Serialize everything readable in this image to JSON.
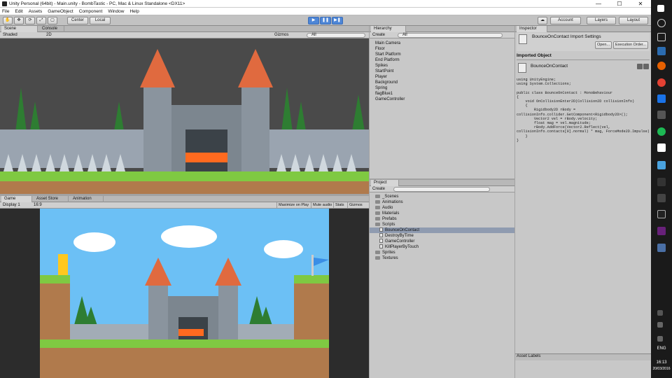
{
  "window": {
    "title": "Unity Personal (64bit) - Main.unity - BombTastic - PC, Mac & Linux Standalone <DX11>",
    "minimize": "—",
    "maximize": "☐",
    "close": "✕"
  },
  "menu": [
    "File",
    "Edit",
    "Assets",
    "GameObject",
    "Component",
    "Window",
    "Help"
  ],
  "toolbar": {
    "pivot": "Center",
    "space": "Local",
    "account": "Account",
    "layers": "Layers",
    "layout": "Layout",
    "play_icon": "▶",
    "pause_icon": "❚❚",
    "step_icon": "▶❚"
  },
  "scene": {
    "tabs": [
      "Scene",
      "Console"
    ],
    "shading": "Shaded",
    "mode_2d": "2D",
    "gizmos": "Gizmos",
    "search_placeholder": "All"
  },
  "game": {
    "tabs": [
      "Game",
      "Asset Store",
      "Animation"
    ],
    "display": "Display 1",
    "aspect": "16:9",
    "toggles": [
      "Maximize on Play",
      "Mute audio",
      "Stats",
      "Gizmos"
    ]
  },
  "hierarchy": {
    "title": "Hierarchy",
    "create": "Create",
    "search_placeholder": "All",
    "items": [
      "Main Camera",
      "Floor",
      "Start Platform",
      "End Platform",
      "Spikes",
      "StartPoint",
      "Player",
      "Background",
      "Spring",
      "flagBlue1",
      "GameController"
    ]
  },
  "project": {
    "title": "Project",
    "create": "Create",
    "folders": [
      "_Scenes",
      "Animations",
      "Audio",
      "Materials",
      "Prefabs",
      "Scripts",
      "Sprites",
      "Textures"
    ],
    "scripts": [
      "BounceOnContact",
      "DestroyByTime",
      "GameController",
      "KillPlayerByTouch"
    ]
  },
  "inspector": {
    "title": "Inspector",
    "import_title": "BounceOnContact Import Settings",
    "open": "Open...",
    "exec_order": "Execution Order...",
    "imported_object": "Imported Object",
    "asset_name": "BounceOnContact",
    "asset_labels": "Asset Labels",
    "code": "using UnityEngine;\nusing System.Collections;\n\npublic class BounceOnContact : MonoBehaviour\n{\n    void OnCollisionEnter2D(Collision2D collisionInfo)\n    {\n        Rigidbody2D rBody =\ncollisionInfo.collider.GetComponent<Rigidbody2D>();\n        Vector2 vel = rBody.velocity;\n        float mag = vel.magnitude;\n        rBody.AddForce(Vector2.Reflect(vel,\ncollisionInfo.contacts[0].normal) * mag, ForceMode2D.Impulse);\n    }\n}"
  },
  "taskbar": {
    "lang": "ENG",
    "time": "16:13",
    "date": "20/03/2016"
  }
}
